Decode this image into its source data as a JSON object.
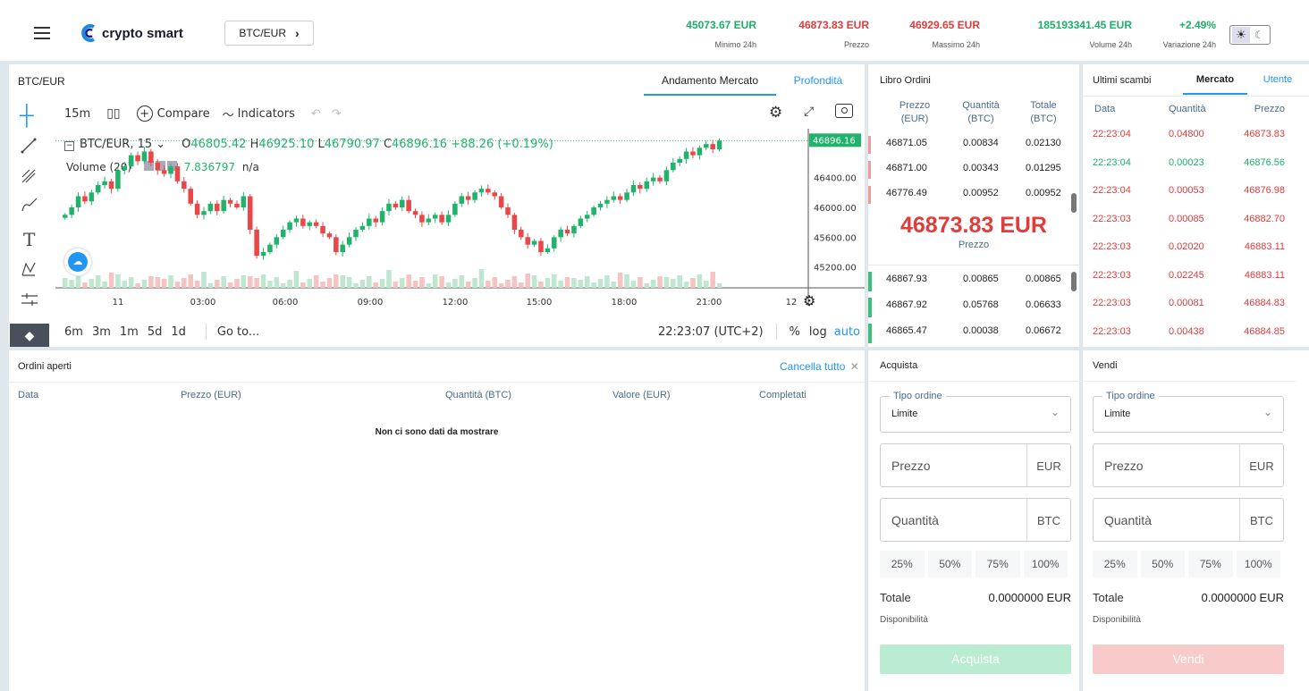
{
  "app": {
    "logo": "crypto smart",
    "pair_button": "BTC/EUR",
    "theme_icon": "sun-moon-toggle"
  },
  "stats": [
    {
      "value": "45073.67 EUR",
      "label": "Minimo 24h",
      "color": "#1fae6b"
    },
    {
      "value": "46873.83 EUR",
      "label": "Prezzo",
      "color": "#e03c3c"
    },
    {
      "value": "46929.65 EUR",
      "label": "Massimo 24h",
      "color": "#e03c3c"
    },
    {
      "value": "185193341.45 EUR",
      "label": "Volume 24h",
      "color": "#1fae6b"
    },
    {
      "value": "+2.49%",
      "label": "Variazione 24h",
      "color": "#1fae6b"
    }
  ],
  "chart_panel": {
    "title": "BTC/EUR",
    "tabs": [
      "Andamento Mercato",
      "Profondità"
    ]
  },
  "tv": {
    "interval": "15m",
    "compare": "Compare",
    "indicators": "Indicators",
    "legend_symbol": "BTC/EUR, 15",
    "o_label": "O",
    "o": "46805.42",
    "h_label": "H",
    "h": "46925.10",
    "l_label": "L",
    "l": "46790.97",
    "c_label": "C",
    "c": "46896.16",
    "chg": "+88.26 (+0.19%)",
    "volume_label": "Volume (20)",
    "volume_value": "7.836797",
    "volume_na": "n/a",
    "ranges": [
      "6m",
      "3m",
      "1m",
      "5d",
      "1d"
    ],
    "goto": "Go to...",
    "time": "22:23:07 (UTC+2)",
    "pct": "%",
    "log": "log",
    "auto": "auto"
  },
  "chart_data": {
    "type": "candlestick",
    "title": "BTC/EUR, 15",
    "x_ticks": [
      "11",
      "03:00",
      "06:00",
      "09:00",
      "12:00",
      "15:00",
      "18:00",
      "21:00",
      "12"
    ],
    "y_ticks": [
      "46400.00",
      "46000.00",
      "45600.00",
      "45200.00"
    ],
    "ylim": [
      44920,
      46960
    ],
    "last_price_label": "46896.16",
    "close": [
      45900,
      46000,
      46150,
      46080,
      46200,
      46300,
      46350,
      46250,
      46500,
      46550,
      46700,
      46620,
      46750,
      46600,
      46500,
      46450,
      46550,
      46350,
      46250,
      46050,
      45900,
      45950,
      46050,
      45950,
      46100,
      46050,
      46000,
      46150,
      45700,
      45350,
      45400,
      45500,
      45600,
      45700,
      45800,
      45850,
      45750,
      45800,
      45750,
      45650,
      45600,
      45400,
      45500,
      45600,
      45700,
      45750,
      45850,
      45800,
      45950,
      46050,
      46000,
      46100,
      45950,
      45900,
      45800,
      45850,
      45900,
      45800,
      45900,
      46050,
      46150,
      46100,
      46200,
      46250,
      46200,
      46150,
      46000,
      45900,
      45700,
      45600,
      45500,
      45550,
      45400,
      45450,
      45600,
      45700,
      45650,
      45750,
      45850,
      45900,
      46000,
      46050,
      46100,
      46150,
      46100,
      46200,
      46300,
      46250,
      46350,
      46400,
      46350,
      46500,
      46600,
      46650,
      46750,
      46700,
      46800,
      46850,
      46780,
      46896
    ]
  },
  "orderbook": {
    "title": "Libro Ordini",
    "headers": [
      "Prezzo (EUR)",
      "Quantità (BTC)",
      "Totale (BTC)"
    ],
    "asks": [
      [
        "46871.05",
        "0.00834",
        "0.02130"
      ],
      [
        "46871.00",
        "0.00343",
        "0.01295"
      ],
      [
        "46776.49",
        "0.00952",
        "0.00952"
      ]
    ],
    "last_price": "46873.83 EUR",
    "last_label": "Prezzo",
    "bids": [
      [
        "46867.93",
        "0.00865",
        "0.00865"
      ],
      [
        "46867.92",
        "0.05768",
        "0.06633"
      ],
      [
        "46865.47",
        "0.00038",
        "0.06672"
      ]
    ]
  },
  "trades": {
    "title": "Ultimi scambi",
    "tabs": [
      "Mercato",
      "Utente"
    ],
    "headers": [
      "Data",
      "Quantità",
      "Prezzo"
    ],
    "rows": [
      {
        "time": "22:23:04",
        "qty": "0.04800",
        "price": "46873.83",
        "side": "sell"
      },
      {
        "time": "22:23:04",
        "qty": "0.00023",
        "price": "46876.56",
        "side": "buy"
      },
      {
        "time": "22:23:04",
        "qty": "0.00053",
        "price": "46876.98",
        "side": "sell"
      },
      {
        "time": "22:23:03",
        "qty": "0.00085",
        "price": "46882.70",
        "side": "sell"
      },
      {
        "time": "22:23:03",
        "qty": "0.02020",
        "price": "46883.11",
        "side": "sell"
      },
      {
        "time": "22:23:03",
        "qty": "0.02245",
        "price": "46883.11",
        "side": "sell"
      },
      {
        "time": "22:23:03",
        "qty": "0.00081",
        "price": "46884.83",
        "side": "sell"
      },
      {
        "time": "22:23:03",
        "qty": "0.00438",
        "price": "46884.85",
        "side": "sell"
      }
    ]
  },
  "open_orders": {
    "title": "Ordini aperti",
    "cancel_all": "Cancella tutto",
    "headers": [
      "Data",
      "Prezzo (EUR)",
      "Quantità (BTC)",
      "Valore (EUR)",
      "Completati"
    ],
    "empty": "Non ci sono dati da mostrare"
  },
  "buy": {
    "title": "Acquista",
    "order_type_label": "Tipo ordine",
    "order_type": "Limite",
    "price_placeholder": "Prezzo",
    "price_unit": "EUR",
    "qty_placeholder": "Quantità",
    "qty_unit": "BTC",
    "percents": [
      "25%",
      "50%",
      "75%",
      "100%"
    ],
    "total_label": "Totale",
    "total_value": "0.0000000 EUR",
    "avail_label": "Disponibilità",
    "submit": "Acquista"
  },
  "sell": {
    "title": "Vendi",
    "order_type_label": "Tipo ordine",
    "order_type": "Limite",
    "price_placeholder": "Prezzo",
    "price_unit": "EUR",
    "qty_placeholder": "Quantità",
    "qty_unit": "BTC",
    "percents": [
      "25%",
      "50%",
      "75%",
      "100%"
    ],
    "total_label": "Totale",
    "total_value": "0.0000000 EUR",
    "avail_label": "Disponibilità",
    "submit": "Vendi"
  }
}
